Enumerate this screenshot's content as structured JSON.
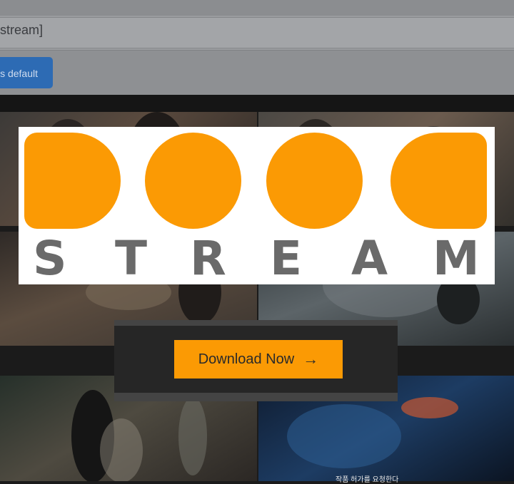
{
  "settings": {
    "input_value": "stream]",
    "default_button_label": "s default"
  },
  "logo": {
    "letters": [
      "S",
      "T",
      "R",
      "E",
      "A",
      "M"
    ],
    "accent_color": "#fb9a04"
  },
  "download": {
    "button_label": "Download Now",
    "icon": "arrow-right-icon"
  },
  "video_subtitle": "작품 허가를 요청한다"
}
